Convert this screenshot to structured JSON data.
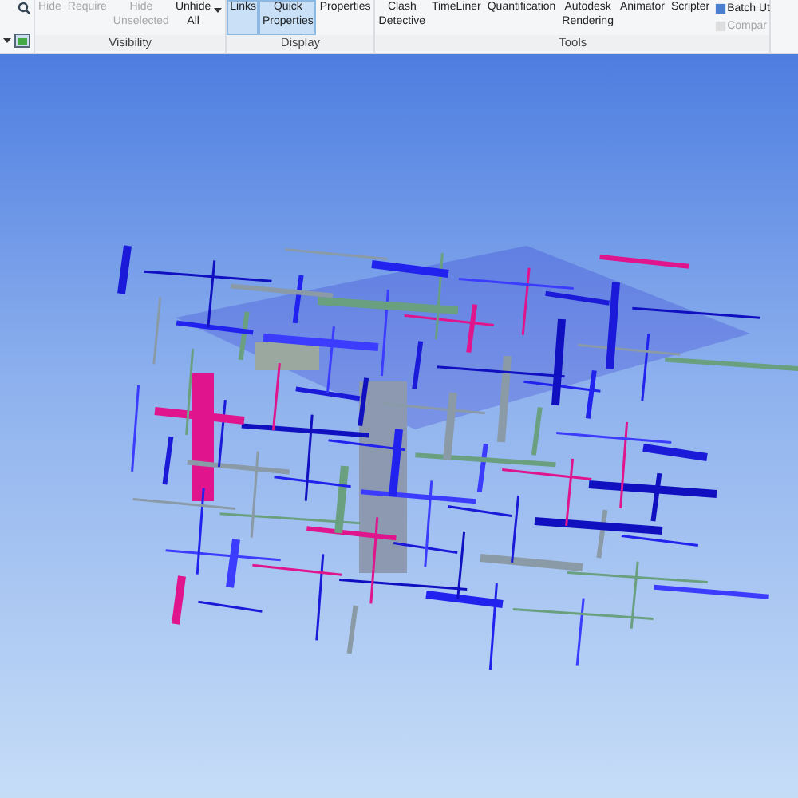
{
  "ribbon": {
    "groups": [
      {
        "label": "Visibility",
        "buttons": [
          {
            "label": "Hide",
            "disabled": true,
            "selected": false,
            "caret": false
          },
          {
            "label": "Require",
            "disabled": true,
            "selected": false,
            "caret": false
          },
          {
            "label": "Hide Unselected",
            "disabled": true,
            "selected": false,
            "caret": false
          },
          {
            "label": "Unhide All",
            "disabled": false,
            "selected": false,
            "caret": true
          }
        ]
      },
      {
        "label": "Display",
        "buttons": [
          {
            "label": "Links",
            "disabled": false,
            "selected": true,
            "caret": false
          },
          {
            "label": "Quick Properties",
            "disabled": false,
            "selected": true,
            "caret": false
          },
          {
            "label": "Properties",
            "disabled": false,
            "selected": false,
            "caret": false
          }
        ]
      },
      {
        "label": "Tools",
        "buttons": [
          {
            "label": "Clash Detective",
            "disabled": false,
            "selected": false,
            "caret": false
          },
          {
            "label": "TimeLiner",
            "disabled": false,
            "selected": false,
            "caret": false
          },
          {
            "label": "Quantification",
            "disabled": false,
            "selected": false,
            "caret": false
          },
          {
            "label": "Autodesk Rendering",
            "disabled": false,
            "selected": false,
            "caret": false
          },
          {
            "label": "Animator",
            "disabled": false,
            "selected": false,
            "caret": false
          },
          {
            "label": "Scripter",
            "disabled": false,
            "selected": false,
            "caret": false
          }
        ],
        "small_buttons": [
          {
            "label": "Batch Ut",
            "disabled": false
          },
          {
            "label": "Compar",
            "disabled": true
          }
        ]
      }
    ]
  }
}
